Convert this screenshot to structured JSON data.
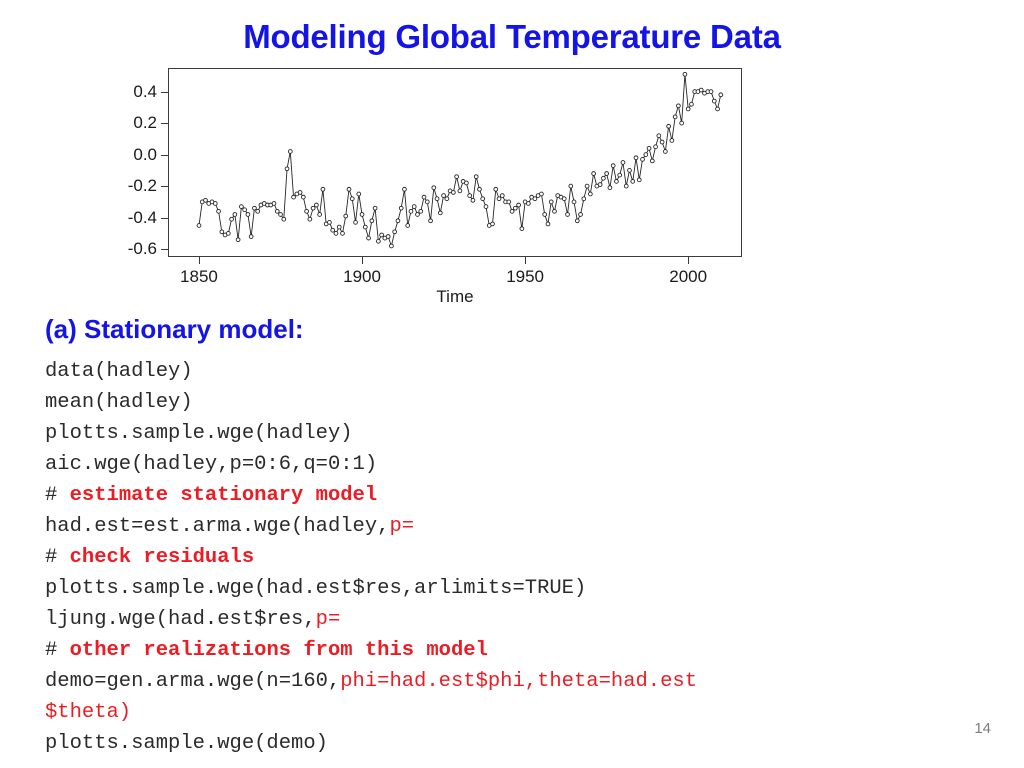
{
  "slide": {
    "title": "Modeling Global Temperature Data",
    "page_number": "14",
    "title_color": "#1414E6",
    "comment_color": "#ED1C24",
    "code_color": "#2b2b2b"
  },
  "section": {
    "heading": "(a) Stationary model:"
  },
  "chart_data": {
    "type": "line",
    "title": "",
    "xlabel": "Time",
    "ylabel": "",
    "xlim": [
      1850,
      2010
    ],
    "ylim": [
      -0.65,
      0.55
    ],
    "xticks": [
      1850,
      1900,
      1950,
      2000
    ],
    "xtick_labels": [
      "1850",
      "1900",
      "1950",
      "2000"
    ],
    "yticks": [
      0.4,
      0.2,
      0.0,
      -0.2,
      -0.4,
      -0.6
    ],
    "ytick_labels": [
      "0.4",
      "0.2",
      "0.0",
      "-0.2",
      "-0.4",
      "-0.6"
    ],
    "grid": false,
    "legend": null,
    "marker": "open-circle",
    "series": [
      {
        "name": "hadley",
        "x_start": 1850,
        "x_step": 1,
        "values": [
          -0.45,
          -0.3,
          -0.29,
          -0.31,
          -0.3,
          -0.31,
          -0.36,
          -0.49,
          -0.51,
          -0.5,
          -0.41,
          -0.38,
          -0.54,
          -0.33,
          -0.35,
          -0.38,
          -0.52,
          -0.34,
          -0.36,
          -0.32,
          -0.31,
          -0.32,
          -0.32,
          -0.31,
          -0.36,
          -0.38,
          -0.41,
          -0.09,
          0.02,
          -0.27,
          -0.25,
          -0.24,
          -0.27,
          -0.36,
          -0.41,
          -0.34,
          -0.32,
          -0.38,
          -0.22,
          -0.44,
          -0.43,
          -0.48,
          -0.5,
          -0.46,
          -0.5,
          -0.39,
          -0.22,
          -0.28,
          -0.43,
          -0.25,
          -0.38,
          -0.46,
          -0.53,
          -0.42,
          -0.34,
          -0.55,
          -0.51,
          -0.53,
          -0.52,
          -0.58,
          -0.49,
          -0.42,
          -0.34,
          -0.22,
          -0.45,
          -0.36,
          -0.33,
          -0.38,
          -0.36,
          -0.27,
          -0.3,
          -0.42,
          -0.21,
          -0.28,
          -0.37,
          -0.26,
          -0.28,
          -0.23,
          -0.24,
          -0.14,
          -0.23,
          -0.17,
          -0.18,
          -0.26,
          -0.29,
          -0.14,
          -0.22,
          -0.28,
          -0.33,
          -0.45,
          -0.44,
          -0.22,
          -0.28,
          -0.26,
          -0.3,
          -0.3,
          -0.36,
          -0.34,
          -0.32,
          -0.47,
          -0.3,
          -0.31,
          -0.27,
          -0.28,
          -0.26,
          -0.25,
          -0.38,
          -0.44,
          -0.3,
          -0.36,
          -0.26,
          -0.27,
          -0.28,
          -0.38,
          -0.2,
          -0.3,
          -0.42,
          -0.38,
          -0.28,
          -0.2,
          -0.25,
          -0.12,
          -0.2,
          -0.19,
          -0.15,
          -0.12,
          -0.21,
          -0.07,
          -0.17,
          -0.13,
          -0.05,
          -0.2,
          -0.1,
          -0.17,
          -0.02,
          -0.16,
          -0.03,
          0.0,
          0.04,
          -0.04,
          0.05,
          0.12,
          0.08,
          0.02,
          0.18,
          0.09,
          0.24,
          0.31,
          0.2,
          0.51,
          0.29,
          0.32,
          0.4,
          0.4,
          0.41,
          0.39,
          0.4,
          0.4,
          0.34,
          0.29,
          0.38
        ]
      }
    ]
  },
  "code": {
    "lines": [
      [
        {
          "t": "data(hadley)",
          "c": "plain"
        }
      ],
      [
        {
          "t": "mean(hadley)",
          "c": "plain"
        }
      ],
      [
        {
          "t": "plotts.sample.wge(hadley)",
          "c": "plain"
        }
      ],
      [
        {
          "t": "aic.wge(hadley,p=0:6,q=0:1)",
          "c": "plain"
        }
      ],
      [
        {
          "t": "# ",
          "c": "hash"
        },
        {
          "t": "estimate stationary model",
          "c": "comment"
        }
      ],
      [
        {
          "t": "had.est=est.arma.wge(hadley,",
          "c": "plain"
        },
        {
          "t": "p=",
          "c": "red"
        }
      ],
      [
        {
          "t": "# ",
          "c": "hash"
        },
        {
          "t": "check residuals",
          "c": "comment"
        }
      ],
      [
        {
          "t": "plotts.sample.wge(had.est$res,arlimits=TRUE)",
          "c": "plain"
        }
      ],
      [
        {
          "t": "ljung.wge(had.est$res,",
          "c": "plain"
        },
        {
          "t": "p=",
          "c": "red"
        }
      ],
      [
        {
          "t": "# ",
          "c": "hash"
        },
        {
          "t": "other realizations from this model",
          "c": "comment"
        }
      ],
      [
        {
          "t": "demo=gen.arma.wge(n=160,",
          "c": "plain"
        },
        {
          "t": "phi=had.est$phi,theta=had.est",
          "c": "red"
        }
      ],
      [
        {
          "t": "$theta)",
          "c": "red"
        }
      ],
      [
        {
          "t": "plotts.sample.wge(demo)",
          "c": "plain"
        }
      ]
    ]
  }
}
